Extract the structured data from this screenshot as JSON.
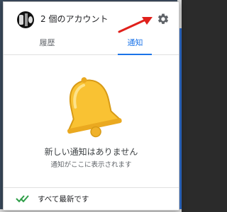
{
  "header": {
    "account_count_label": "2 個のアカウント",
    "settings_icon": "gear-icon",
    "avatar_icon": "account-avatar"
  },
  "tabs": [
    {
      "label": "履歴",
      "selected": false
    },
    {
      "label": "通知",
      "selected": true
    }
  ],
  "empty_state": {
    "icon": "bell-icon",
    "title": "新しい通知はありません",
    "subtitle": "通知がここに表示されます"
  },
  "footer": {
    "icon": "double-check-icon",
    "label": "すべて最新です"
  },
  "colors": {
    "accent": "#1a73e8",
    "bell": "#f9c233",
    "check": "#2e9e48",
    "annotation_arrow": "#e0201b"
  }
}
